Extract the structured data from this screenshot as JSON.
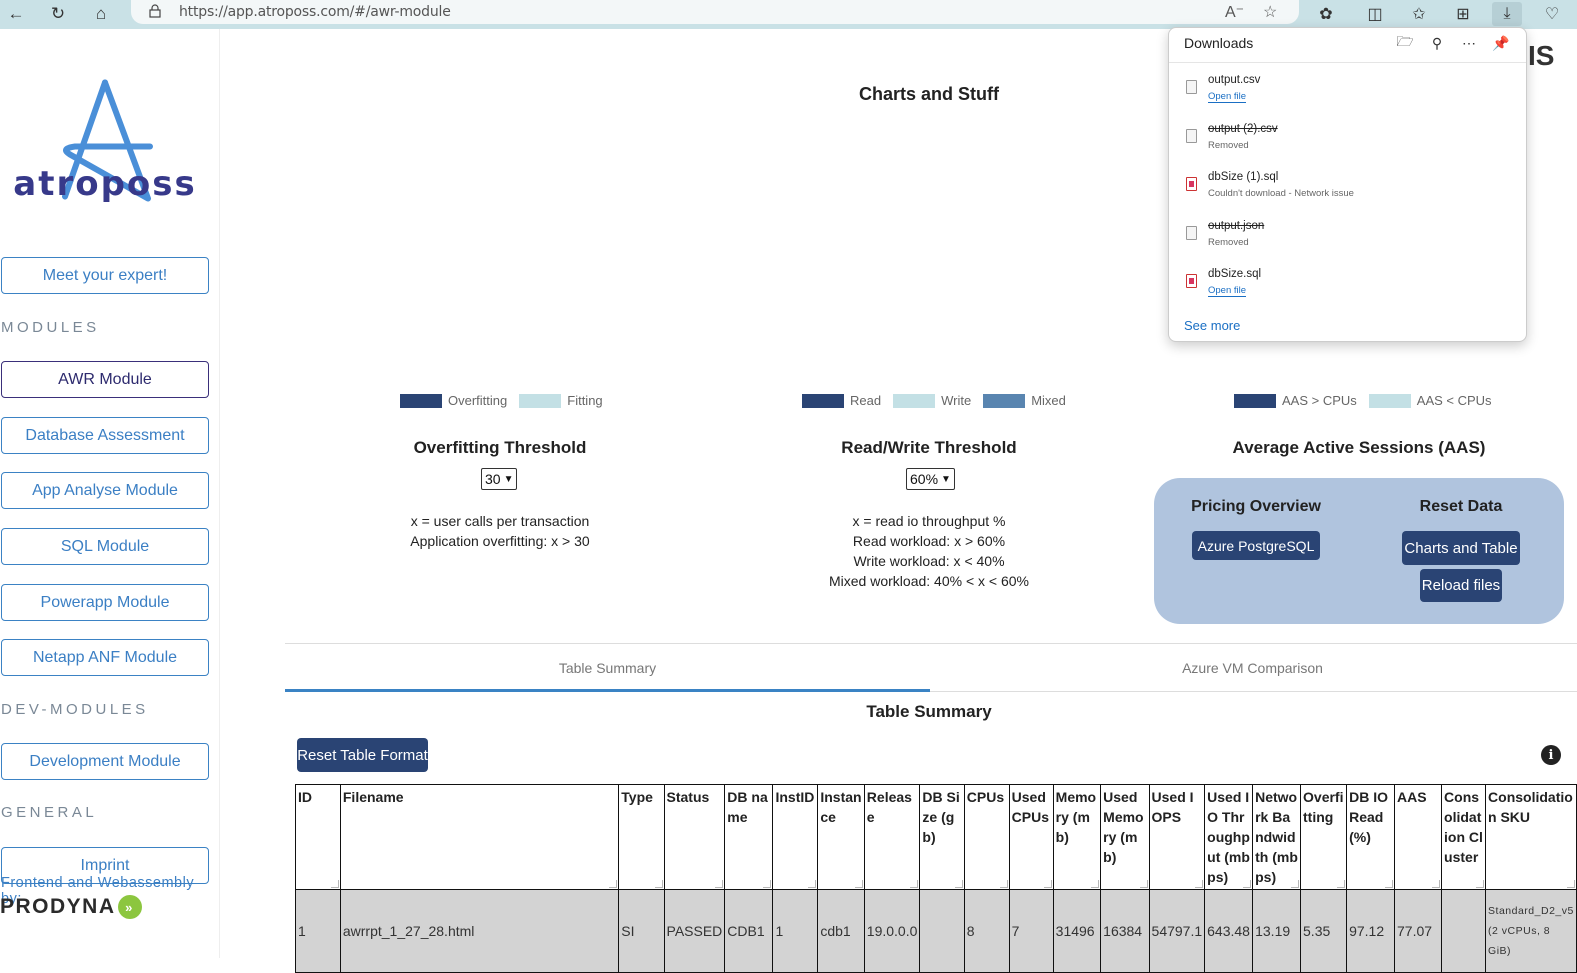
{
  "browser": {
    "url": "https://app.atroposs.com/#/awr-module",
    "icons": [
      "back-icon",
      "reload-icon",
      "home-icon",
      "lock-icon",
      "read-aloud-icon",
      "favorite-star-icon",
      "extensions-icon",
      "split-screen-icon",
      "favorites-icon",
      "collections-icon",
      "downloads-icon",
      "browser-essentials-icon"
    ]
  },
  "downloads": {
    "title": "Downloads",
    "items": [
      {
        "name": "output.csv",
        "status": "Open file",
        "removed": false,
        "type": "doc"
      },
      {
        "name": "output (2).csv",
        "status": "Removed",
        "removed": true,
        "type": "doc"
      },
      {
        "name": "dbSize (1).sql",
        "status": "Couldn't download - Network issue",
        "removed": false,
        "type": "sql"
      },
      {
        "name": "output.json",
        "status": "Removed",
        "removed": true,
        "type": "json"
      },
      {
        "name": "dbSize.sql",
        "status": "Open file",
        "removed": false,
        "type": "sql"
      }
    ],
    "see_more": "See more"
  },
  "sidebar": {
    "logo_text": "atroposs",
    "meet_expert": "Meet your expert!",
    "modules_label": "MODULES",
    "modules": [
      {
        "label": "AWR Module",
        "active": true
      },
      {
        "label": "Database Assessment",
        "active": false
      },
      {
        "label": "App Analyse Module",
        "active": false
      },
      {
        "label": "SQL Module",
        "active": false
      },
      {
        "label": "Powerapp Module",
        "active": false
      },
      {
        "label": "Netapp ANF Module",
        "active": false
      }
    ],
    "dev_label": "DEV-MODULES",
    "dev_modules": [
      {
        "label": "Development Module"
      }
    ],
    "general_label": "GENERAL",
    "general": [
      {
        "label": "Imprint"
      }
    ],
    "credit": "Frontend and Webassembly by:",
    "partner": "PRODYNA"
  },
  "main": {
    "title": "Charts and Stuff",
    "brand_fragment": "IS",
    "overfitting": {
      "legend": [
        {
          "label": "Overfitting",
          "color": "#2a4474"
        },
        {
          "label": "Fitting",
          "color": "#c3e0e5"
        }
      ],
      "title": "Overfitting Threshold",
      "selected": "30",
      "desc": [
        "x = user calls per transaction",
        "Application overfitting: x > 30"
      ]
    },
    "readwrite": {
      "legend": [
        {
          "label": "Read",
          "color": "#2a4474"
        },
        {
          "label": "Write",
          "color": "#c3e0e5"
        },
        {
          "label": "Mixed",
          "color": "#5985b0"
        }
      ],
      "title": "Read/Write Threshold",
      "selected": "60%",
      "desc": [
        "x = read io throughput %",
        "Read workload: x > 60%",
        "Write workload: x < 40%",
        "Mixed workload: 40% < x < 60%"
      ]
    },
    "aas": {
      "legend": [
        {
          "label": "AAS > CPUs",
          "color": "#2a4474"
        },
        {
          "label": "AAS < CPUs",
          "color": "#c3e0e5"
        }
      ],
      "title": "Average Active Sessions (AAS)"
    },
    "panel": {
      "pricing_title": "Pricing Overview",
      "pricing_button": "Azure PostgreSQL",
      "reset_title": "Reset Data",
      "reset_charts_button": "Charts and Table",
      "reload_button": "Reload files"
    },
    "tabs": [
      {
        "label": "Table Summary",
        "active": true
      },
      {
        "label": "Azure VM Comparison",
        "active": false
      }
    ],
    "table_title": "Table Summary",
    "reset_table_button": "Reset Table Format",
    "table": {
      "columns": [
        "ID",
        "Filename",
        "Type",
        "Status",
        "DB name",
        "InstID",
        "Instance",
        "Release",
        "DB Size (gb)",
        "CPUs",
        "Used CPUs",
        "Memory (mb)",
        "Used Memory (mb)",
        "Used IOPS",
        "Used IO Throughput (mbps)",
        "Network Bandwidth (mbps)",
        "Overfitting",
        "DB IO Read (%)",
        "AAS",
        "Consolidation Cluster",
        "Consolidation SKU"
      ],
      "rows": [
        [
          "1",
          "awrrpt_1_27_28.html",
          "SI",
          "PASSED",
          "CDB1",
          "1",
          "cdb1",
          "19.0.0.0",
          "",
          "8",
          "7",
          "31496",
          "16384",
          "54797.1",
          "643.48",
          "13.19",
          "5.35",
          "97.12",
          "77.07",
          "",
          "Standard_D2_v5 (2 vCPUs, 8 GiB)"
        ]
      ]
    }
  }
}
